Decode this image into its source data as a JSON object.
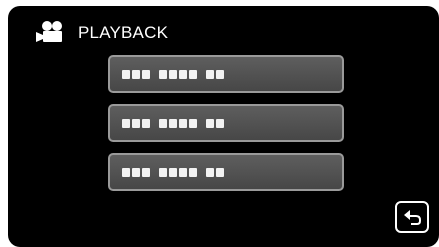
{
  "header": {
    "icon": "video-camera-icon",
    "title": "PLAYBACK"
  },
  "menu": {
    "items": [
      {
        "label_icon": "placeholder-text-blocks",
        "groups": [
          3,
          4,
          2
        ]
      },
      {
        "label_icon": "placeholder-text-blocks",
        "groups": [
          3,
          4,
          2
        ]
      },
      {
        "label_icon": "placeholder-text-blocks",
        "groups": [
          3,
          4,
          2
        ]
      }
    ]
  },
  "footer": {
    "back_icon": "return-arrow-icon"
  },
  "colors": {
    "background": "#000000",
    "button_fill": "#555555",
    "button_border": "#9a9a9a",
    "text": "#ffffff"
  }
}
